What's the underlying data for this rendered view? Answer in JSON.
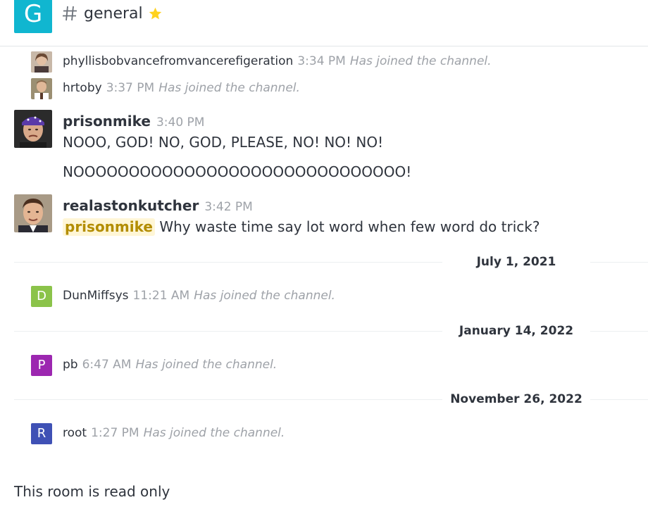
{
  "header": {
    "room_avatar_letter": "G",
    "room_avatar_color": "#10b6d0",
    "room_name": "general",
    "star_color": "#ffd21f"
  },
  "messages": [
    {
      "type": "system",
      "user": "phyllisbobvancefromvancerefigeration",
      "time": "3:34 PM",
      "note": "Has joined the channel."
    },
    {
      "type": "system",
      "user": "hrtoby",
      "time": "3:37 PM",
      "note": "Has joined the channel."
    },
    {
      "type": "message",
      "user": "prisonmike",
      "time": "3:40 PM",
      "lines": [
        "NOOO, GOD! NO, GOD, PLEASE, NO! NO! NO!",
        "NOOOOOOOOOOOOOOOOOOOOOOOOOOOOOO!"
      ]
    },
    {
      "type": "message",
      "user": "realastonkutcher",
      "time": "3:42 PM",
      "mention": "prisonmike",
      "text": "Why waste time say lot word when few word do trick?"
    }
  ],
  "dividers": [
    "July 1, 2021",
    "January 14, 2022",
    "November 26, 2022"
  ],
  "joins": [
    {
      "letter": "D",
      "color": "#8bc34a",
      "user": "DunMiffsys",
      "time": "11:21 AM",
      "note": "Has joined the channel."
    },
    {
      "letter": "P",
      "color": "#9c27b0",
      "user": "pb",
      "time": "6:47 AM",
      "note": "Has joined the channel."
    },
    {
      "letter": "R",
      "color": "#3f51b5",
      "user": "root",
      "time": "1:27 PM",
      "note": "Has joined the channel."
    }
  ],
  "footer": {
    "readonly_text": "This room is read only"
  }
}
